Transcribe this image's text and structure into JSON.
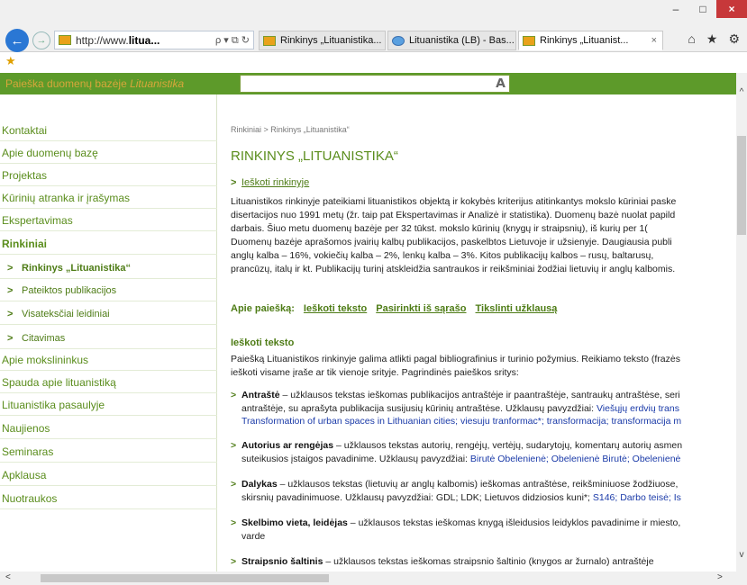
{
  "browser": {
    "window_buttons": {
      "minimize": "–",
      "maximize": "□",
      "close": "×"
    },
    "address": {
      "prefix": "http://www.",
      "bold": "litua...",
      "tools": "ρ ▾ ⧉ ↻"
    },
    "tabs": [
      {
        "label": "Rinkinys „Lituanistika...",
        "icon": "lituanistika-favicon"
      },
      {
        "label": "Lituanistika (LB) - Bas...",
        "icon": "ie-favicon"
      },
      {
        "label": "Rinkinys „Lituanist...",
        "icon": "lituanistika-favicon",
        "close": "×",
        "active": true
      }
    ],
    "right_icons": {
      "home": "⌂",
      "favorites": "★",
      "settings": "⚙"
    },
    "back": "←",
    "forward": "→"
  },
  "header": {
    "search_label_prefix": "Paieška duomenų bazėje ",
    "search_label_italic": "Lituanistika",
    "search_value": "",
    "search_icon": "magnifier"
  },
  "sidebar": {
    "items": [
      {
        "label": "Kontaktai"
      },
      {
        "label": "Apie duomenų bazę"
      },
      {
        "label": "Projektas"
      },
      {
        "label": "Kūrinių atranka ir įrašymas"
      },
      {
        "label": "Ekspertavimas"
      },
      {
        "label": "Rinkiniai"
      },
      {
        "label": "Rinkinys „Lituanistika“"
      },
      {
        "label": "Pateiktos publikacijos"
      },
      {
        "label": "Visateksčiai leidiniai"
      },
      {
        "label": "Citavimas"
      },
      {
        "label": "Apie mokslininkus"
      },
      {
        "label": "Spauda apie lituanistiką"
      },
      {
        "label": "Lituanistika pasaulyje"
      },
      {
        "label": "Naujienos"
      },
      {
        "label": "Seminaras"
      },
      {
        "label": "Apklausa"
      },
      {
        "label": "Nuotraukos"
      }
    ]
  },
  "main": {
    "breadcrumb": "Rinkiniai > Rinkinys „Lituanistika“",
    "title": "RINKINYS „LITUANISTIKA“",
    "search_link": "Ieškoti rinkinyje",
    "intro": [
      "Lituanistikos rinkinyje pateikiami lituanistikos objektą ir kokybės kriterijus atitinkantys mokslo kūriniai paske",
      "disertacijos nuo 1991 metų (žr. taip pat  Ekspertavimas ir Analizė ir statistika). Duomenų bazė nuolat papild",
      "darbais. Šiuo metu duomenų bazėje per 32 tūkst. mokslo kūrinių (knygų ir straipsnių), iš kurių per 1(",
      "Duomenų bazėje aprašomos įvairių kalbų publikacijos, paskelbtos Lietuvoje ir užsienyje. Daugiausia publi",
      "anglų kalba – 16%, vokiečių kalba – 2%, lenkų kalba – 3%. Kitos publikacijų kalbos – rusų, baltarusų,",
      "prancūzų, italų ir kt. Publikacijų turinį atskleidžia santraukos ir reikšminiai žodžiai lietuvių ir anglų kalbomis."
    ],
    "about": {
      "label": "Apie paiešką:",
      "links": [
        "Ieškoti teksto",
        "Pasirinkti iš sąrašo",
        "Tikslinti užklausą"
      ]
    },
    "section_title": "Ieškoti teksto",
    "section_intro": [
      "Paiešką Lituanistikos rinkinyje galima atlikti pagal bibliografinius ir turinio požymius. Reikiamo teksto (frazės",
      "ieškoti visame įraše ar tik vienoje srityje. Pagrindinės paieškos sritys:"
    ],
    "fields": [
      {
        "term": "Antraštė",
        "line1": " – užklausos tekstas ieškomas publikacijos antraštėje ir paantraštėje, santraukų antraštėse, seri",
        "line2_plain": "antraštėje, su aprašyta publikacija susijusių kūrinių antraštėse. Užklausų pavyzdžiai: ",
        "line2_ex": "Viešųjų erdvių trans",
        "line3_ex": "Transformation of urban spaces in Lithuanian cities; viesuju tranformac*; transformacija; transformacija m"
      },
      {
        "term": "Autorius ar rengėjas",
        "line1": " – užklausos tekstas autorių, rengėjų, vertėjų, sudarytojų, komentarų autorių asmen",
        "line2_plain": "suteikusios įstaigos pavadinime. Užklausų pavyzdžiai: ",
        "line2_ex": "Birutė Obelenienė; Obelenienė Birutė; Obelenienė"
      },
      {
        "term": "Dalykas",
        "line1": " – užklausos tekstas (lietuvių ar anglų kalbomis) ieškomas antraštėse, reikšminiuose žodžiuose,",
        "line2_plain": "skirsnių pavadinimuose. Užklausų pavyzdžiai: GDL; LDK; Lietuvos didziosios kuni*; ",
        "line2_ex": "S146; Darbo teisė; Is"
      },
      {
        "term": "Skelbimo vieta, leidėjas",
        "line1": " – užklausos tekstas ieškomas knygą išleidusios leidyklos pavadinime ir miesto,",
        "line2_plain": "varde",
        "line2_ex": ""
      },
      {
        "term": "Straipsnio šaltinis",
        "line1": " – užklausos tekstas ieškomas straipsnio šaltinio (knygos ar žurnalo) antraštėje",
        "line2_plain": "",
        "line2_ex": ""
      }
    ]
  },
  "colors": {
    "green": "#5d9a2a",
    "link_green": "#4e7c16",
    "label_gold": "#d7a63b",
    "example_blue": "#1a3aa8"
  }
}
